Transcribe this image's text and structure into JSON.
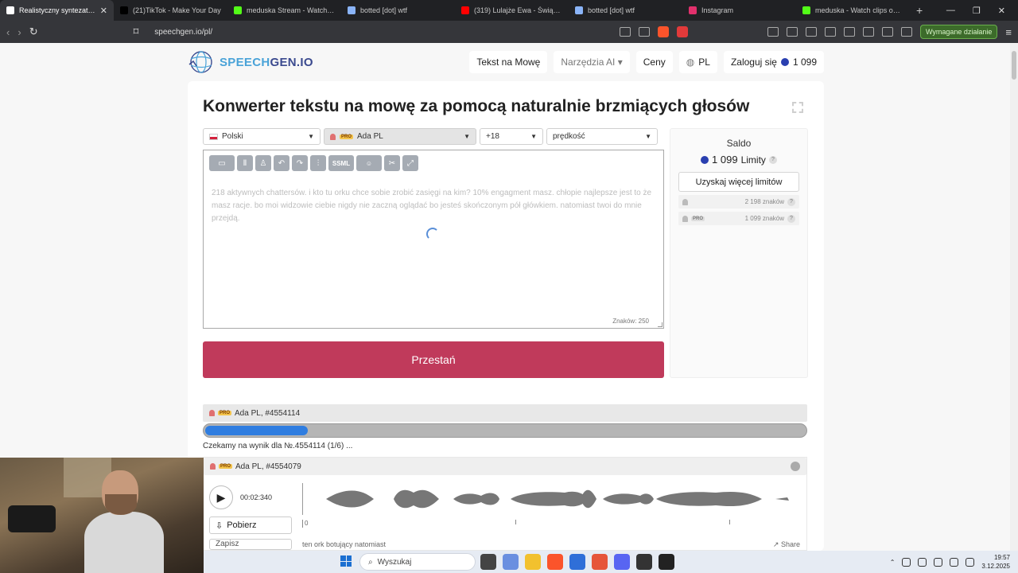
{
  "browser": {
    "tabs": [
      {
        "title": "Realistyczny syntezator mo",
        "active": true,
        "color": "#ffffff"
      },
      {
        "title": "(21)TikTok - Make Your Day",
        "active": false,
        "color": "#000000"
      },
      {
        "title": "meduska Stream - Watch Live o",
        "active": false,
        "color": "#53fc18"
      },
      {
        "title": "botted [dot] wtf",
        "active": false,
        "color": "#8ab4f8"
      },
      {
        "title": "(319) Lulajże Ewa - Świąteczna",
        "active": false,
        "color": "#ff0000"
      },
      {
        "title": "botted [dot] wtf",
        "active": false,
        "color": "#8ab4f8"
      },
      {
        "title": "Instagram",
        "active": false,
        "color": "#e1306c"
      },
      {
        "title": "meduska - Watch clips on Kick",
        "active": false,
        "color": "#53fc18"
      }
    ],
    "new_tab": "+",
    "url": "speechgen.io/pl/",
    "required_action": "Wymagane działanie"
  },
  "site": {
    "logo_a": "SPEECH",
    "logo_b": "GEN.IO",
    "menu": {
      "tts": "Tekst na Mowę",
      "tools": "Narzędzia AI ▾",
      "pricing": "Ceny",
      "lang": "PL",
      "login": "Zaloguj się",
      "balance": "1 099"
    }
  },
  "converter": {
    "title": "Konwerter tekstu na mowę za pomocą naturalnie brzmiących głosów",
    "language": "Polski",
    "voice": "Ada PL",
    "pitch": "+18",
    "speed_placeholder": "prędkość",
    "toolbar": {
      "ssml": "SSML"
    },
    "text": "218 aktywnych chattersów. i kto tu orku chce sobie zrobić zasięgi na kim? 10% engagment masz. chłopie najlepsze jest to że masz racje. bo moi widzowie ciebie nigdy nie zaczną oglądać bo jesteś skończonym pół główkiem. natomiast twoi do mnie przejdą.",
    "char_count": "Znaków: 250",
    "stop_button": "Przestań"
  },
  "sidebar": {
    "saldo": "Saldo",
    "limits_value": "1 099",
    "limits_label": "Limity",
    "get_more": "Uzyskaj więcej limitów",
    "rows": [
      {
        "value": "2 198 znaków"
      },
      {
        "value": "1 099 znaków"
      }
    ],
    "help": "?"
  },
  "jobs": {
    "pending": {
      "title": "Ada PL, #4554114",
      "progress_fraction": 0.17,
      "status": "Czekamy na wynik dla №.4554114 (1/6) ..."
    },
    "done": {
      "title": "Ada PL, #4554079",
      "time": "00:02:340",
      "download": "Pobierz",
      "save": "Zapisz",
      "caption": "ten ork botujący natomiast",
      "share": "Share",
      "tick0": "0"
    }
  },
  "taskbar": {
    "search": "Wyszukaj",
    "time": "19:57",
    "date": "3.12.2025"
  },
  "colors": {
    "accent": "#c03a5b",
    "progress": "#2f7de0",
    "logo_blue": "#4aa3d8",
    "logo_dark": "#3b4a8f"
  }
}
